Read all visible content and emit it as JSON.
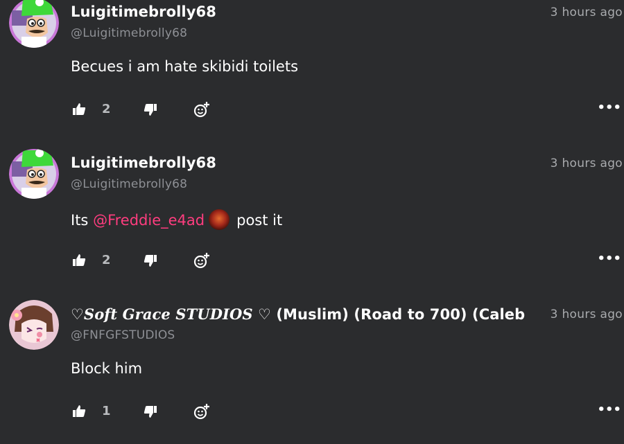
{
  "comments": [
    {
      "username": "Luigitimebrolly68",
      "handle": "@Luigitimebrolly68",
      "timestamp": "3 hours ago",
      "body": "Becues i am hate skibidi toilets",
      "likes": "2",
      "avatar_icon": "luigi-avatar"
    },
    {
      "username": "Luigitimebrolly68",
      "handle": "@Luigitimebrolly68",
      "timestamp": "3 hours ago",
      "body_prefix": "Its",
      "mention": "@Freddie_e4ad",
      "body_suffix": "post it",
      "likes": "2",
      "avatar_icon": "luigi-avatar"
    },
    {
      "username_fancy": "♡𝑺𝒐𝒇𝒕 𝑮𝒓𝒂𝒄𝒆 𝑺𝑻𝑼𝑫𝑰𝑶𝑺 ♡",
      "username_rest": " (Muslim) (Road to 700) (Caleb",
      "handle": "@FNFGFSTUDIOS",
      "timestamp": "3 hours ago",
      "body": "Block him",
      "likes": "1",
      "avatar_icon": "anime-girl-avatar"
    }
  ],
  "icons": {
    "like": "thumbs-up-icon",
    "dislike": "thumbs-down-icon",
    "react": "add-reaction-icon",
    "more": "more-options-icon"
  },
  "actions": {
    "more_label": "•••"
  },
  "colors": {
    "background": "#2b2c2e",
    "mention": "#ff3d7f",
    "muted": "#8e9095"
  }
}
